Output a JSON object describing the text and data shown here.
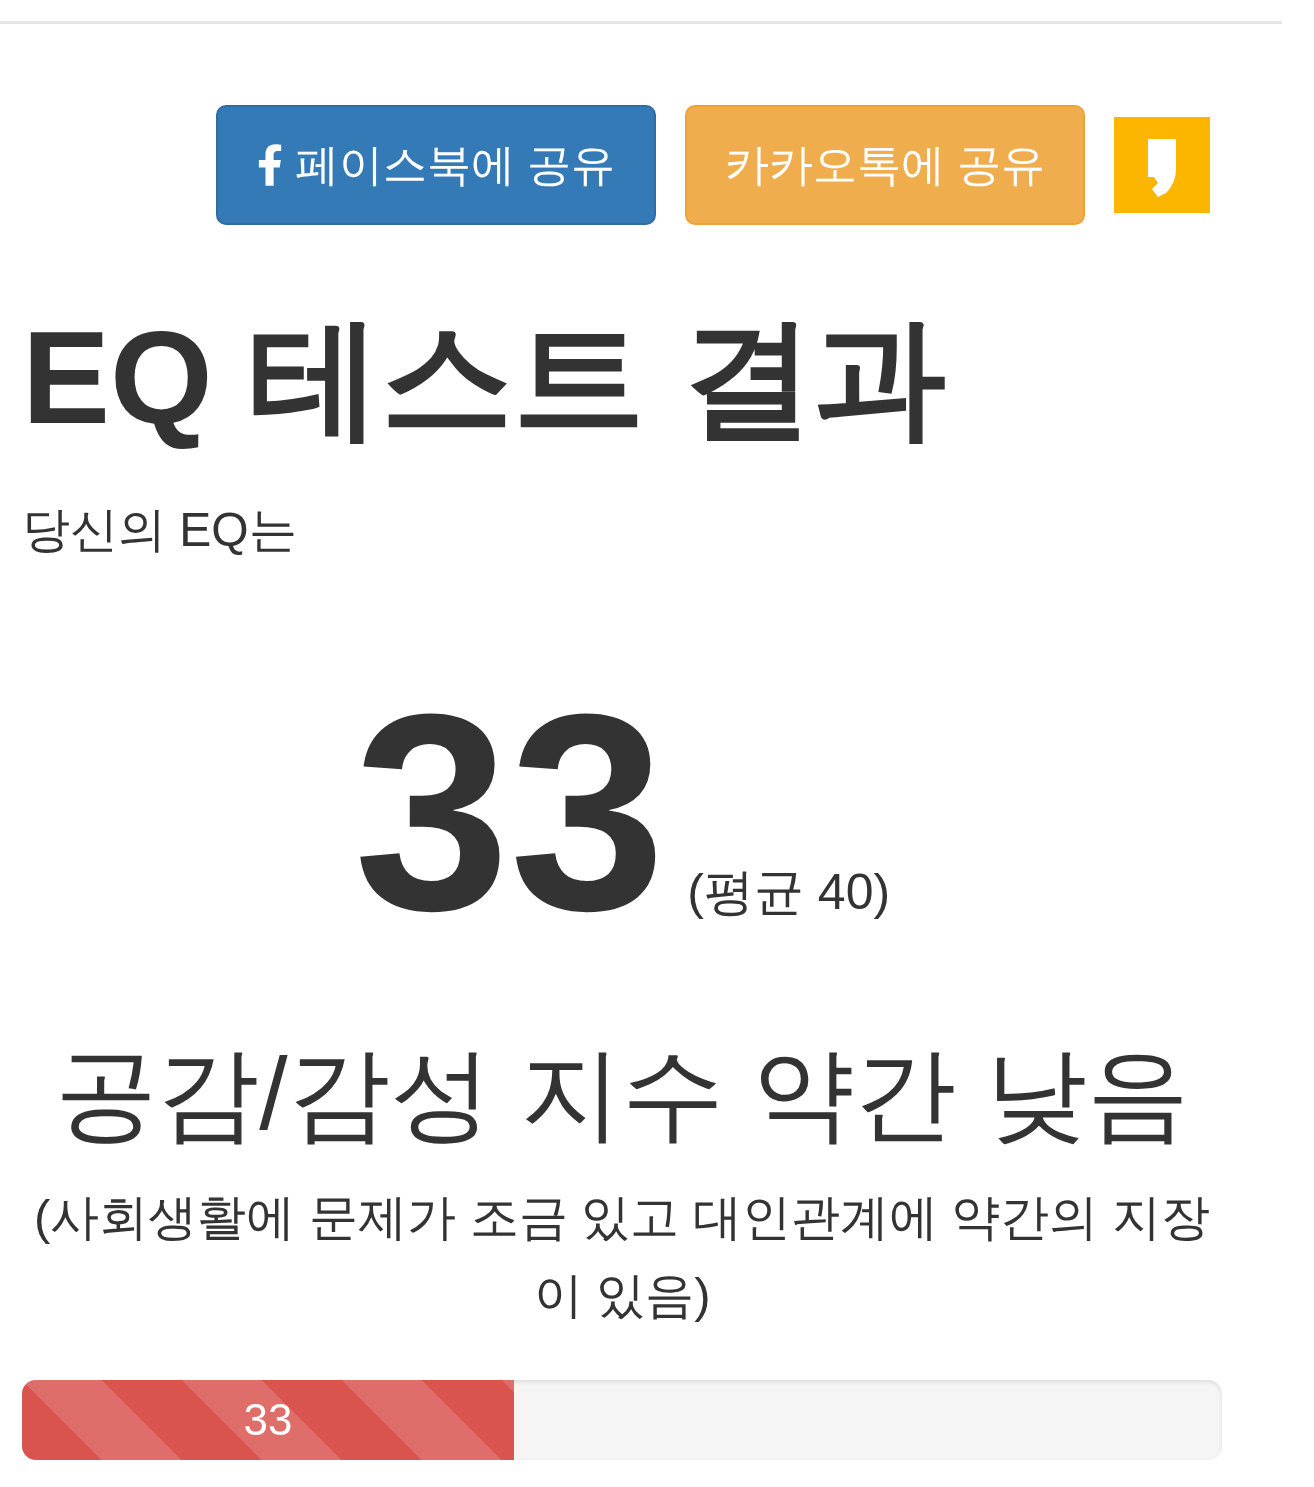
{
  "share_buttons": [
    {
      "kind": "facebook",
      "label": "페이스북에 공유"
    },
    {
      "kind": "kakaotalk",
      "label": "카카오톡에 공유"
    },
    {
      "kind": "kakaostory"
    }
  ],
  "title": "EQ 테스트 결과",
  "intro": "당신의 EQ는",
  "score": {
    "value": "33",
    "average": "(평균 40)"
  },
  "verdict": "공감/감성 지수 약간 낮음",
  "description": "(사회생활에 문제가 조금 있고 대인관계에 약간의 지장이 있음)",
  "progress": {
    "level": 0.41,
    "label": "33"
  }
}
